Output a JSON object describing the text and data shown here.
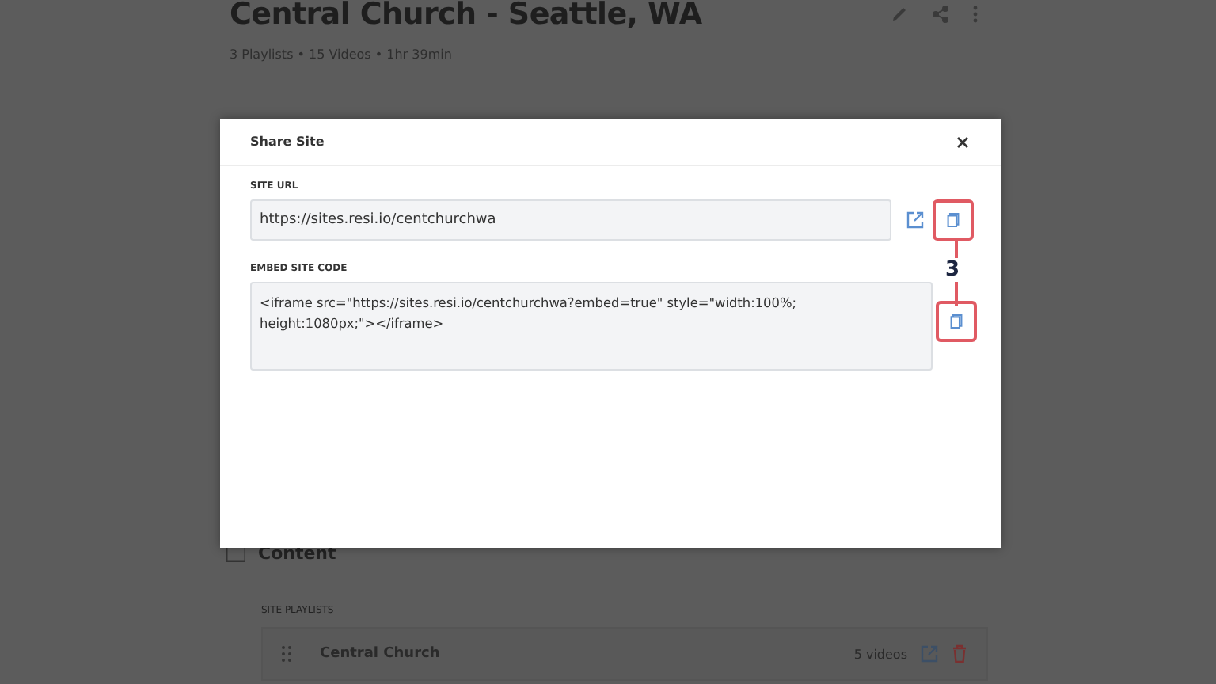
{
  "page": {
    "title": "Central Church - Seattle, WA",
    "subtitle": "3 Playlists • 15 Videos • 1hr 39min",
    "section_title": "Content",
    "playlists_label": "SITE PLAYLISTS",
    "playlists": [
      {
        "name": "Central Church",
        "count": "5 videos"
      }
    ]
  },
  "dialog": {
    "title": "Share Site",
    "url_label": "SITE URL",
    "url_value": "https://sites.resi.io/centchurchwa",
    "embed_label": "EMBED SITE CODE",
    "embed_value": "<iframe src=\"https://sites.resi.io/centchurchwa?embed=true\" style=\"width:100%; height:1080px;\"></iframe>"
  },
  "annotation": {
    "label": "3"
  }
}
